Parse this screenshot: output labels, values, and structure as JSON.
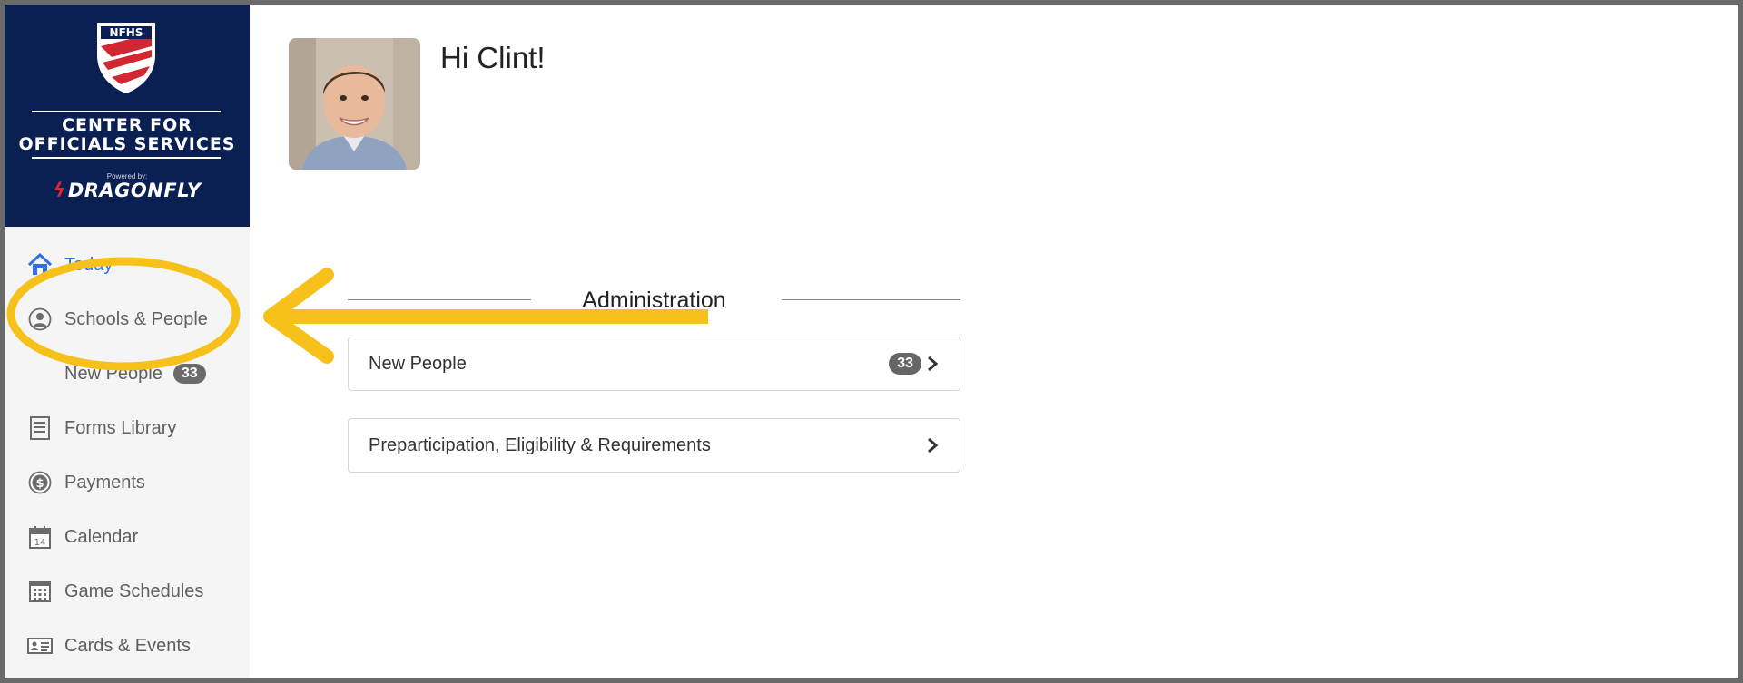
{
  "brand": {
    "shield_text": "NFHS",
    "line1": "CENTER FOR",
    "line2": "OFFICIALS SERVICES",
    "powered_by": "Powered by:",
    "product": "DRAGONFLY"
  },
  "sidebar": {
    "items": [
      {
        "label": "Today",
        "icon": "home-icon",
        "active": true
      },
      {
        "label": "Schools & People",
        "icon": "user-circle-icon"
      },
      {
        "label": "New People",
        "badge": "33",
        "sub": true
      },
      {
        "label": "Forms Library",
        "icon": "forms-icon"
      },
      {
        "label": "Payments",
        "icon": "dollar-circle-icon"
      },
      {
        "label": "Calendar",
        "icon": "calendar-icon"
      },
      {
        "label": "Game Schedules",
        "icon": "grid-calendar-icon"
      },
      {
        "label": "Cards & Events",
        "icon": "id-card-icon"
      }
    ]
  },
  "header": {
    "greeting": "Hi Clint!"
  },
  "main": {
    "section_title": "Administration",
    "cards": [
      {
        "label": "New People",
        "badge": "33"
      },
      {
        "label": "Preparticipation, Eligibility & Requirements"
      }
    ]
  },
  "colors": {
    "brand_navy": "#0a1f52",
    "active_link": "#2f6fe0",
    "annotation_yellow": "#f7c11c",
    "brand_red": "#e0262f"
  }
}
